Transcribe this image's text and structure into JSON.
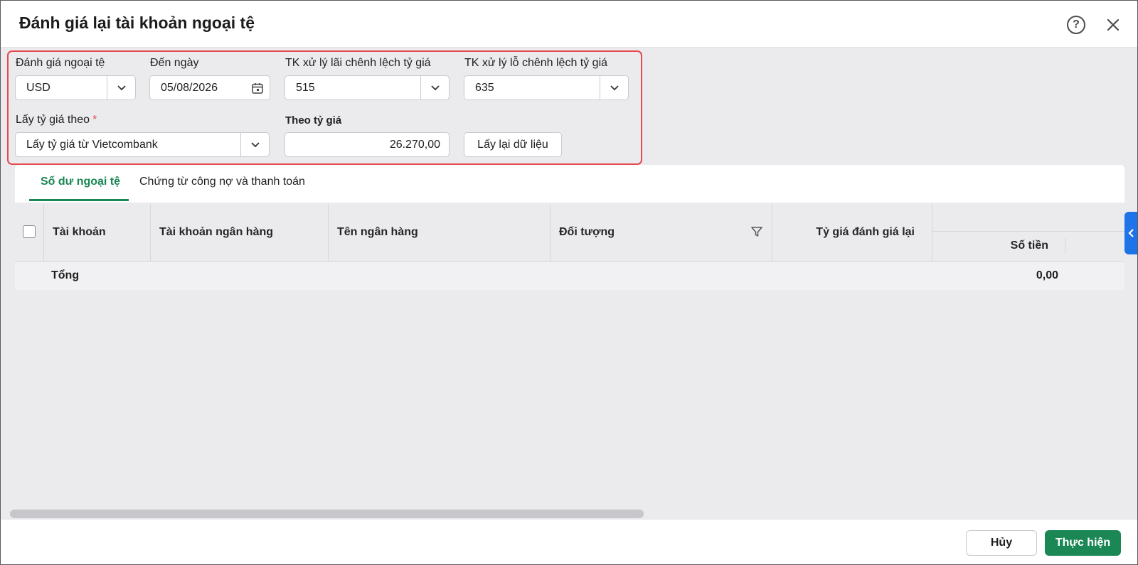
{
  "dialog": {
    "title": "Đánh giá lại tài khoản ngoại tệ"
  },
  "filters": {
    "currency_label": "Đánh giá ngoại tệ",
    "currency_value": "USD",
    "date_label": "Đến ngày",
    "date_value": "05/08/2026",
    "gain_account_label": "TK xử lý lãi chênh lệch tỷ giá",
    "gain_account_value": "515",
    "loss_account_label": "TK xử lý lỗ chênh lệch tỷ giá",
    "loss_account_value": "635",
    "rate_source_label": "Lấy tỷ giá theo",
    "rate_source_required": "*",
    "rate_source_value": "Lấy tỷ giá từ Vietcombank",
    "rate_label": "Theo tỷ giá",
    "rate_value": "26.270,00",
    "reload_button": "Lấy lại dữ liệu"
  },
  "tabs": [
    {
      "label": "Số dư ngoại tệ",
      "active": true
    },
    {
      "label": "Chứng từ công nợ và thanh toán",
      "active": false
    }
  ],
  "grid": {
    "columns": [
      "Tài khoản",
      "Tài khoản ngân hàng",
      "Tên ngân hàng",
      "Đối tượng",
      "Tỷ giá đánh giá lại",
      "Số tiền"
    ],
    "total_label": "Tổng",
    "total_value": "0,00"
  },
  "footer": {
    "cancel": "Hủy",
    "submit": "Thực hiện"
  },
  "colors": {
    "accent": "#1a8754",
    "highlight_border": "#e5484d",
    "side_toggle": "#1e73e8"
  },
  "icons": [
    "help-icon",
    "close-icon",
    "chevron-down-icon",
    "calendar-icon",
    "filter-icon",
    "chevron-left-icon"
  ]
}
